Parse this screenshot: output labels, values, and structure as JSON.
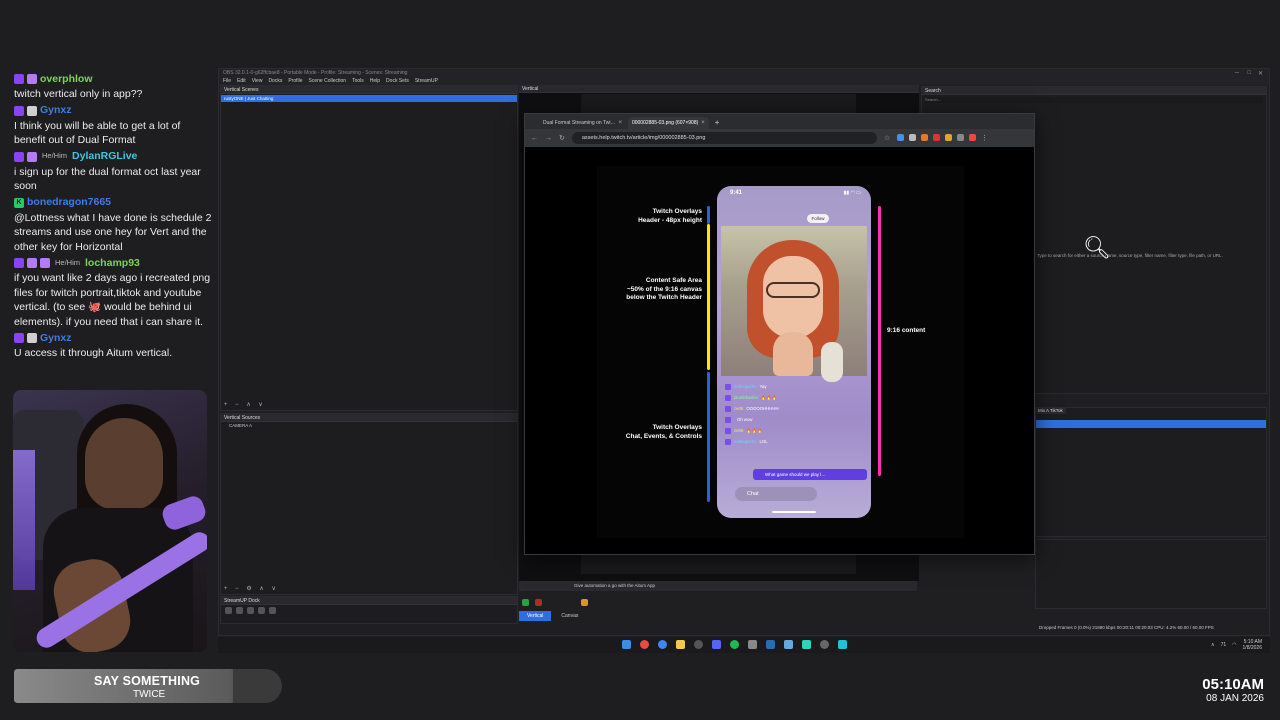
{
  "chat": [
    {
      "badges": [
        "twitch",
        "sub-purple"
      ],
      "pronoun": "",
      "user": "overphlow",
      "color": "#7fd35a",
      "text": "twitch vertical only in app??"
    },
    {
      "badges": [
        "twitch",
        "sub"
      ],
      "pronoun": "",
      "user": "Gynxz",
      "color": "#3d7de6",
      "text": "I think you will be able to get a lot of benefit out of Dual Format"
    },
    {
      "badges": [
        "twitch",
        "sub-purple"
      ],
      "pronoun": "He/Him",
      "user": "DylanRGLive",
      "color": "#3cc6e6",
      "text": "i sign up for the dual format oct last year soon"
    },
    {
      "badges": [
        "kick"
      ],
      "pronoun": "",
      "user": "bonedragon7665",
      "color": "#3d7de6",
      "text": "@Lottness what I have done is schedule 2 streams and use one hey for Vert and the other key for Horizontal"
    },
    {
      "badges": [
        "twitch",
        "sub-green",
        "emote"
      ],
      "pronoun": "He/Him",
      "user": "lochamp93",
      "color": "#7fd35a",
      "text": "if you want like 2 days ago i recreated png files for twitch portrait,tiktok and youtube vertical. (to see 🐙 would be behind ui elements). if you need that i can share it."
    },
    {
      "badges": [
        "twitch",
        "sub"
      ],
      "pronoun": "",
      "user": "Gynxz",
      "color": "#3d7de6",
      "text": "U access it through Aitum vertical."
    }
  ],
  "song": {
    "title": "SAY SOMETHING",
    "artist": "TWICE"
  },
  "clock": {
    "time": "05:10AM",
    "date": "08 JAN 2026"
  },
  "obs": {
    "titlebar": "OBS 32.0.1-0-g62ffcbae8 - Portable Mode - Profile: Streaming - Scenes: Streaming",
    "menu": [
      "File",
      "Edit",
      "View",
      "Docks",
      "Profile",
      "Scene Collection",
      "Tools",
      "Help",
      "Dock Sets",
      "StreamUP"
    ],
    "scenes_title": "Vertical Scenes",
    "scene_active": "rustyONE | Just Chatting",
    "sources_title": "Vertical Sources",
    "source_item": "CAMERA A",
    "streamup_title": "StreamUP Dock",
    "preview_title": "Vertical",
    "search_title": "Search",
    "search_placeholder": "Search...",
    "search_hint": "Type to search for either a source name, source type, filter name, filter type, file path, or URL.",
    "tiktok_tab": "Mix A TikTok",
    "bottom_banner": "Give automation a go with the Aitum App",
    "view_tabs": [
      "Vertical",
      "Canvas"
    ],
    "status": "Dropped Frames 0 (0.0%)   21880 kbps   00:20:11   00:20:03  CPU: 4.2%  60.00 / 60.00 FPS"
  },
  "browser": {
    "tabs": [
      {
        "label": "Dual Format Streaming on Twi…",
        "active": false
      },
      {
        "label": "000002885-03.png (607×908)",
        "active": true
      }
    ],
    "url": "assets.help.twitch.tv/article/img/000002885-03.png"
  },
  "diagram": {
    "annotations": {
      "header": "Twitch Overlays\nHeader - 48px height",
      "safe": "Content Safe Area\n~50% of the 9:16 canvas\nbelow the Twitch Header",
      "overlays": "Twitch Overlays\nChat, Events, & Controls",
      "content": "9:16 content"
    },
    "phone": {
      "time": "9:41",
      "follow": "Follow",
      "pinned": "What game should we play l…",
      "chat_placeholder": "Chat",
      "chat": [
        {
          "user": "nothegachu",
          "text": "Yay",
          "class": ""
        },
        {
          "user": "plumbkaslex",
          "text": "🔥🔥🔥",
          "class": "g"
        },
        {
          "user": "ze05",
          "text": "OOOOOHHHHH",
          "class": "y"
        },
        {
          "user": "",
          "text": "Oh wow",
          "class": ""
        },
        {
          "user": "ze05",
          "text": "🔥🔥🔥",
          "class": "y"
        },
        {
          "user": "nothegachu",
          "text": "LOL",
          "class": ""
        }
      ]
    },
    "colors": {
      "header": "#2f5fe0",
      "safe": "#ffe600",
      "overlay": "#2f5fe0",
      "content": "#ff2fb5"
    }
  },
  "taskbar": {
    "time": "5:10 AM",
    "date": "1/8/2026",
    "temp": "71"
  }
}
